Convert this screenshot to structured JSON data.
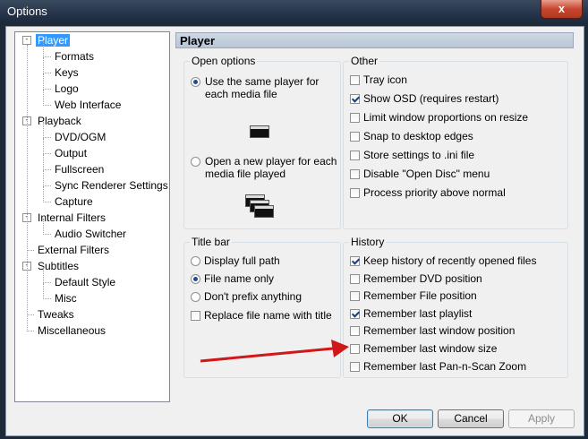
{
  "window": {
    "title": "Options",
    "close_label": "x"
  },
  "tree": {
    "items": [
      {
        "label": "Player",
        "level": 0,
        "selected": true,
        "expander": "-"
      },
      {
        "label": "Formats",
        "level": 1
      },
      {
        "label": "Keys",
        "level": 1
      },
      {
        "label": "Logo",
        "level": 1
      },
      {
        "label": "Web Interface",
        "level": 1
      },
      {
        "label": "Playback",
        "level": 0,
        "expander": "-"
      },
      {
        "label": "DVD/OGM",
        "level": 1
      },
      {
        "label": "Output",
        "level": 1
      },
      {
        "label": "Fullscreen",
        "level": 1
      },
      {
        "label": "Sync Renderer Settings",
        "level": 1
      },
      {
        "label": "Capture",
        "level": 1
      },
      {
        "label": "Internal Filters",
        "level": 0,
        "expander": "-"
      },
      {
        "label": "Audio Switcher",
        "level": 1
      },
      {
        "label": "External Filters",
        "level": 0
      },
      {
        "label": "Subtitles",
        "level": 0,
        "expander": "-"
      },
      {
        "label": "Default Style",
        "level": 1
      },
      {
        "label": "Misc",
        "level": 1
      },
      {
        "label": "Tweaks",
        "level": 0
      },
      {
        "label": "Miscellaneous",
        "level": 0
      }
    ]
  },
  "page": {
    "title": "Player"
  },
  "open_options": {
    "legend": "Open options",
    "same_player": "Use the same player for each media file",
    "new_player": "Open a new player for each media file played",
    "selected": "same"
  },
  "other": {
    "legend": "Other",
    "items": [
      {
        "label": "Tray icon",
        "checked": false
      },
      {
        "label": "Show OSD (requires restart)",
        "checked": true
      },
      {
        "label": "Limit window proportions on resize",
        "checked": false
      },
      {
        "label": "Snap to desktop edges",
        "checked": false
      },
      {
        "label": "Store settings to .ini file",
        "checked": false
      },
      {
        "label": "Disable \"Open Disc\" menu",
        "checked": false
      },
      {
        "label": "Process priority above normal",
        "checked": false
      }
    ]
  },
  "title_bar": {
    "legend": "Title bar",
    "options": [
      "Display full path",
      "File name only",
      "Don't prefix anything"
    ],
    "selected_index": 1,
    "replace_label": "Replace file name with title",
    "replace_checked": false
  },
  "history": {
    "legend": "History",
    "items": [
      {
        "label": "Keep history of recently opened files",
        "checked": true
      },
      {
        "label": "Remember DVD position",
        "checked": false
      },
      {
        "label": "Remember File position",
        "checked": false
      },
      {
        "label": "Remember last playlist",
        "checked": true
      },
      {
        "label": "Remember last window position",
        "checked": false
      },
      {
        "label": "Remember last window size",
        "checked": false
      },
      {
        "label": "Remember last Pan-n-Scan Zoom",
        "checked": false
      }
    ]
  },
  "buttons": {
    "ok": "OK",
    "cancel": "Cancel",
    "apply": "Apply"
  },
  "colors": {
    "selection": "#3399ff",
    "arrow": "#d01818"
  }
}
